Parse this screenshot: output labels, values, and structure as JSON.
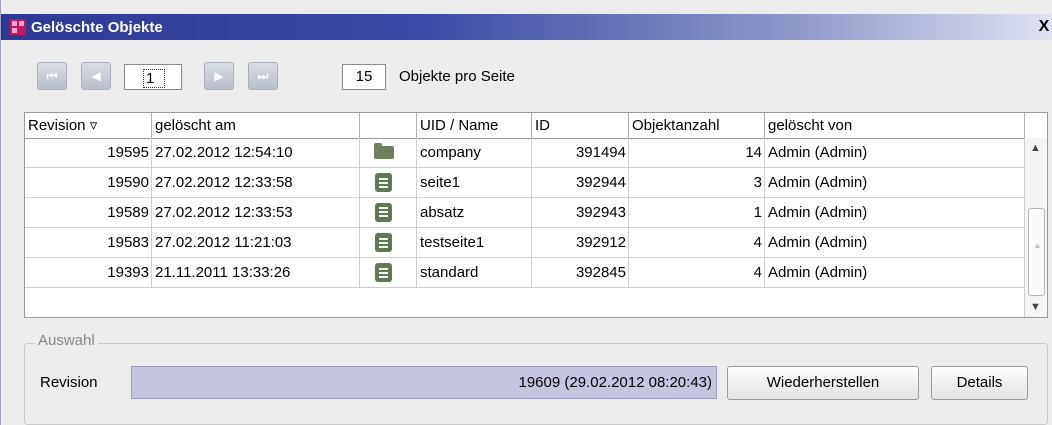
{
  "window": {
    "title": "Gelöschte Objekte",
    "close_glyph": "X",
    "app_icon": "firstspirit-app-icon"
  },
  "pager": {
    "first": "⏮",
    "prev": "◀",
    "next": "▶",
    "last": "⏭",
    "current_page": "1",
    "per_page_value": "15",
    "per_page_label": "Objekte pro Seite"
  },
  "table": {
    "columns": [
      "Revision ▿",
      "gelöscht am",
      "",
      "UID / Name",
      "ID",
      "Objektanzahl",
      "gelöscht von"
    ],
    "rows": [
      {
        "revision": "19595",
        "date": "27.02.2012 12:54:10",
        "icon": "folder-icon",
        "name": "company",
        "id": "391494",
        "count": "14",
        "by": "Admin (Admin)"
      },
      {
        "revision": "19590",
        "date": "27.02.2012 12:33:58",
        "icon": "page-icon",
        "name": "seite1",
        "id": "392944",
        "count": "3",
        "by": "Admin (Admin)"
      },
      {
        "revision": "19589",
        "date": "27.02.2012 12:33:53",
        "icon": "section-icon",
        "name": "absatz",
        "id": "392943",
        "count": "1",
        "by": "Admin (Admin)"
      },
      {
        "revision": "19583",
        "date": "27.02.2012 11:21:03",
        "icon": "page-icon",
        "name": "testseite1",
        "id": "392912",
        "count": "4",
        "by": "Admin (Admin)"
      },
      {
        "revision": "19393",
        "date": "21.11.2011 13:33:26",
        "icon": "page-icon",
        "name": "standard",
        "id": "392845",
        "count": "4",
        "by": "Admin (Admin)"
      }
    ]
  },
  "selection": {
    "group_label": "Auswahl",
    "revision_label": "Revision",
    "revision_value": "19609 (29.02.2012 08:20:43)",
    "restore_button": "Wiederherstellen",
    "details_button": "Details"
  },
  "colors": {
    "title_gradient_start": "#2e3a93",
    "selection_field": "#c4c5df",
    "icon_green": "#5e7a4e"
  }
}
